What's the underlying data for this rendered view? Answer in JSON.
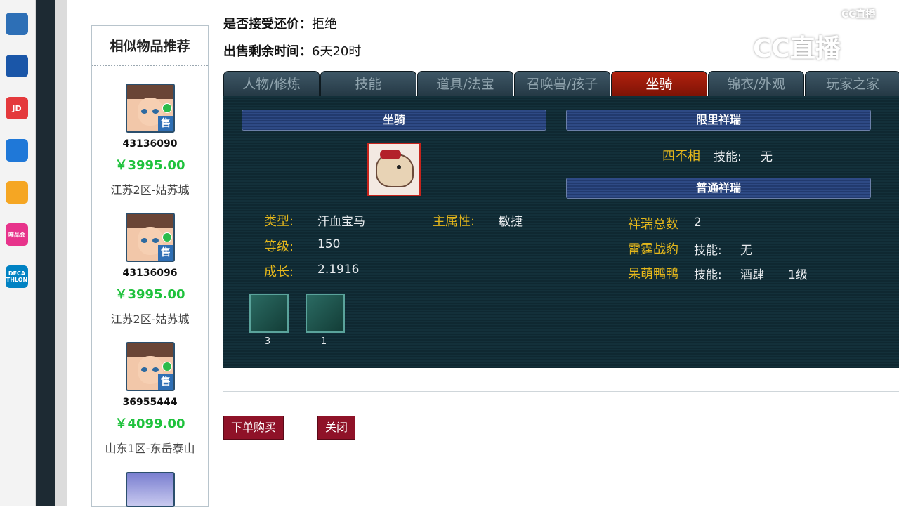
{
  "taskbar": {
    "apps": [
      {
        "icon": "game-app-icon",
        "text": "",
        "color": "#2d6fb6"
      },
      {
        "icon": "blue-wave-app-icon",
        "text": "",
        "color": "#1a56a8"
      },
      {
        "icon": "jd-app-icon",
        "text": "JD",
        "color": "#e4393c"
      },
      {
        "icon": "refresh-app-icon",
        "text": "",
        "color": "#1f78d8"
      },
      {
        "icon": "bear-app-icon",
        "text": "",
        "color": "#f5a623"
      },
      {
        "icon": "vip-app-icon",
        "text": "唯品会",
        "color": "#e7338b"
      },
      {
        "icon": "decathlon-app-icon",
        "text": "DECA THLON",
        "color": "#0082c3"
      }
    ]
  },
  "header": {
    "bargain_label": "是否接受还价：",
    "bargain_value": "拒绝",
    "remaining_label": "出售剩余时间：",
    "remaining_value": "6天20时"
  },
  "sidebar": {
    "title": "相似物品推荐",
    "items": [
      {
        "id": "43136090",
        "price": "￥3995.00",
        "server": "江苏2区-姑苏城",
        "badge": "售"
      },
      {
        "id": "43136096",
        "price": "￥3995.00",
        "server": "江苏2区-姑苏城",
        "badge": "售"
      },
      {
        "id": "36955444",
        "price": "￥4099.00",
        "server": "山东1区-东岳泰山",
        "badge": "售"
      }
    ]
  },
  "tabs": [
    {
      "label": "人物/修炼",
      "active": false
    },
    {
      "label": "技能",
      "active": false
    },
    {
      "label": "道具/法宝",
      "active": false
    },
    {
      "label": "召唤兽/孩子",
      "active": false
    },
    {
      "label": "坐骑",
      "active": true
    },
    {
      "label": "锦衣/外观",
      "active": false
    },
    {
      "label": "玩家之家",
      "active": false
    }
  ],
  "mount": {
    "header": "坐骑",
    "type_label": "类型:",
    "type_value": "汗血宝马",
    "main_attr_label": "主属性:",
    "main_attr_value": "敏捷",
    "level_label": "等级:",
    "level_value": "150",
    "growth_label": "成长:",
    "growth_value": "2.1916",
    "skills": [
      {
        "icon": "mount-skill-1-icon",
        "count": "3"
      },
      {
        "icon": "mount-skill-2-icon",
        "count": "1"
      }
    ]
  },
  "limited": {
    "header": "限里祥瑞",
    "name": "四不相",
    "skill_label": "技能:",
    "skill_value": "无"
  },
  "normal": {
    "header": "普通祥瑞",
    "total_label": "祥瑞总数",
    "total_value": "2",
    "items": [
      {
        "name": "雷霆战豹",
        "skill_label": "技能:",
        "skill_value": "无",
        "level": ""
      },
      {
        "name": "呆萌鸭鸭",
        "skill_label": "技能:",
        "skill_value": "酒肆",
        "level": "1级"
      }
    ]
  },
  "actions": {
    "buy_label": "下单购买",
    "close_label": "关闭"
  },
  "watermark": {
    "text": "CC直播",
    "small": "CC直播"
  }
}
